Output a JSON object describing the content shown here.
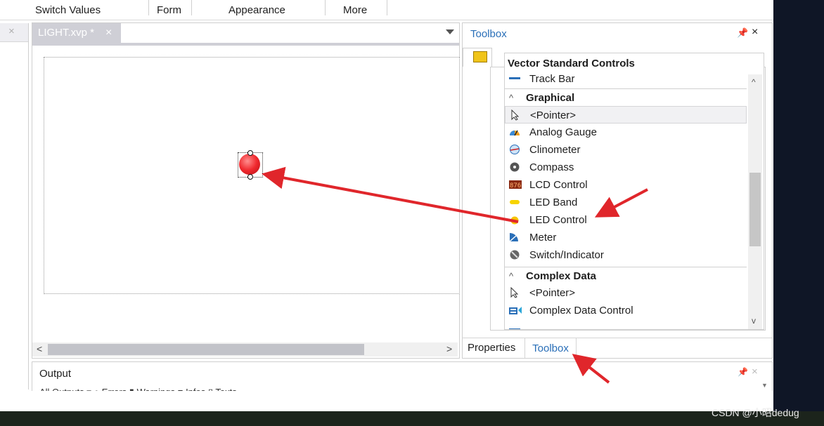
{
  "ribbon": {
    "groups": [
      "Switch Values",
      "Form",
      "Appearance",
      "More"
    ]
  },
  "editor": {
    "doc_tab": "LIGHT.xvp *",
    "close_glyph": "×"
  },
  "toolbox": {
    "title": "Toolbox",
    "header": "Vector Standard Controls",
    "partial_item": "Track Bar",
    "categories": {
      "graphical": "Graphical",
      "complex": "Complex Data"
    },
    "graphical_items": [
      "<Pointer>",
      "Analog Gauge",
      "Clinometer",
      "Compass",
      "LCD Control",
      "LED Band",
      "LED Control",
      "Meter",
      "Switch/Indicator"
    ],
    "complex_items": [
      "<Pointer>",
      "Complex Data Control"
    ],
    "bottom_tabs": {
      "properties": "Properties",
      "toolbox": "Toolbox"
    }
  },
  "output": {
    "title": "Output",
    "toolbar_text": "All Outputs      ▾   ● Errors   ▮ Warnings   ■ Infos   ▯ Texts"
  },
  "watermark": "CSDN @小昭dedug",
  "colors": {
    "accent": "#2a6fb8",
    "annotation_arrow": "#e0262b",
    "led": "#f0292e"
  }
}
